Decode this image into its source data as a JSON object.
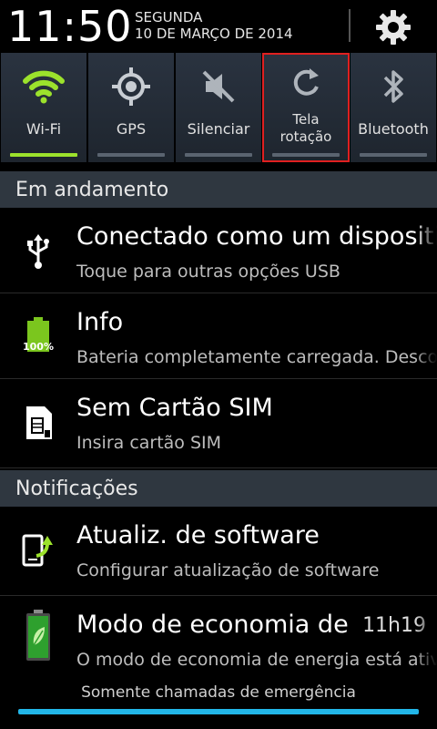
{
  "status": {
    "time": "11:50",
    "day": "SEGUNDA",
    "date": "10 DE MARÇO DE 2014",
    "settings_icon": "gear-icon"
  },
  "quick_settings": [
    {
      "label": "Wi-Fi",
      "icon": "wifi-icon",
      "active": true
    },
    {
      "label": "GPS",
      "icon": "gps-icon",
      "active": false
    },
    {
      "label": "Silenciar",
      "icon": "mute-icon",
      "active": false
    },
    {
      "label_line1": "Tela",
      "label_line2": "rotação",
      "icon": "rotate-icon",
      "active": false,
      "highlighted": true
    },
    {
      "label": "Bluetooth",
      "icon": "bluetooth-icon",
      "active": false
    }
  ],
  "sections": {
    "ongoing": "Em andamento",
    "notifications": "Notificações"
  },
  "ongoing": [
    {
      "title": "Conectado como um dispositivo",
      "subtitle": "Toque para outras opções USB",
      "icon": "usb-icon"
    },
    {
      "title": "Info",
      "subtitle": "Bateria completamente carregada. Desconecte",
      "icon": "battery-full-icon",
      "badge": "100%"
    },
    {
      "title": "Sem Cartão SIM",
      "subtitle": "Insira cartão SIM",
      "icon": "sim-card-icon"
    }
  ],
  "notifications": [
    {
      "title": "Atualiz. de software",
      "subtitle": "Configurar atualização de software",
      "icon": "software-update-icon"
    },
    {
      "title": "Modo de economia de energia",
      "subtitle": "O modo de economia de energia está ativo",
      "time": "11h19",
      "icon": "power-saving-icon"
    }
  ],
  "footer": {
    "text": "Somente chamadas de emergência"
  },
  "colors": {
    "accent_green": "#9ce22c",
    "accent_blue": "#22b6e8",
    "highlight_red": "#e02020"
  }
}
